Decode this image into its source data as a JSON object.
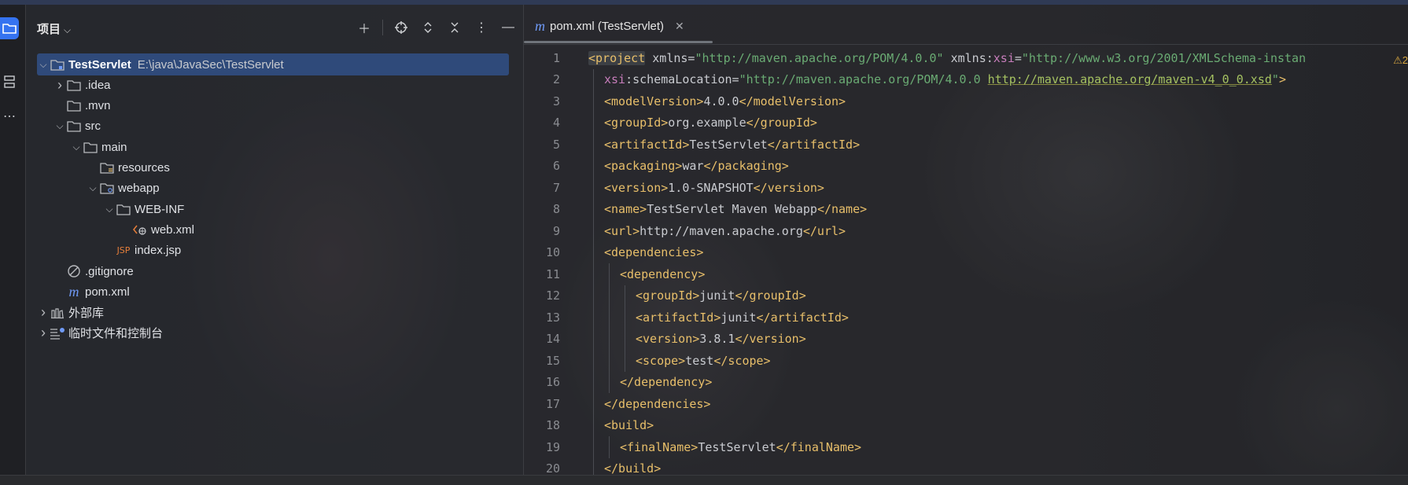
{
  "project_panel": {
    "title": "项目",
    "tree": [
      {
        "label": "TestServlet",
        "path": "E:\\java\\JavaSec\\TestServlet",
        "indent": 0,
        "arrow": "down",
        "icon": "module-folder-icon",
        "selected": true,
        "bold": true
      },
      {
        "label": ".idea",
        "indent": 1,
        "arrow": "right",
        "icon": "folder-icon"
      },
      {
        "label": ".mvn",
        "indent": 1,
        "arrow": "",
        "icon": "folder-icon"
      },
      {
        "label": "src",
        "indent": 1,
        "arrow": "down",
        "icon": "folder-icon"
      },
      {
        "label": "main",
        "indent": 2,
        "arrow": "down",
        "icon": "folder-icon"
      },
      {
        "label": "resources",
        "indent": 3,
        "arrow": "",
        "icon": "resources-folder-icon"
      },
      {
        "label": "webapp",
        "indent": 3,
        "arrow": "down",
        "icon": "web-folder-icon"
      },
      {
        "label": "WEB-INF",
        "indent": 4,
        "arrow": "down",
        "icon": "folder-icon"
      },
      {
        "label": "web.xml",
        "indent": 5,
        "arrow": "",
        "icon": "web-xml-icon"
      },
      {
        "label": "index.jsp",
        "indent": 4,
        "arrow": "",
        "icon": "jsp-file-icon"
      },
      {
        "label": ".gitignore",
        "indent": 1,
        "arrow": "",
        "icon": "gitignore-icon"
      },
      {
        "label": "pom.xml",
        "indent": 1,
        "arrow": "",
        "icon": "maven-file-icon"
      },
      {
        "label": "外部库",
        "indent": 0,
        "arrow": "right",
        "icon": "library-icon"
      },
      {
        "label": "临时文件和控制台",
        "indent": 0,
        "arrow": "right",
        "icon": "scratches-icon"
      }
    ]
  },
  "editor": {
    "tab_label": "pom.xml (TestServlet)",
    "tab_icon": "m",
    "inspection_count": "2",
    "lines": [
      {
        "n": "1",
        "indent": 0,
        "parts": [
          [
            "tag",
            "<project"
          ],
          [
            "attr",
            " xmlns="
          ],
          [
            "str",
            "\"http://maven.apache.org/POM/4.0.0\""
          ],
          [
            "attr",
            " xmlns:"
          ],
          [
            "ns",
            "xsi"
          ],
          [
            "attr",
            "="
          ],
          [
            "str",
            "\"http://www.w3.org/2001/XMLSchema-instan"
          ]
        ]
      },
      {
        "n": "2",
        "indent": 1,
        "parts": [
          [
            "ns",
            "xsi"
          ],
          [
            "attr",
            ":schemaLocation="
          ],
          [
            "str",
            "\"http://maven.apache.org/POM/4.0.0 "
          ],
          [
            "link",
            "http://maven.apache.org/maven-v4_0_0.xsd"
          ],
          [
            "str",
            "\""
          ],
          [
            "tag",
            ">"
          ]
        ]
      },
      {
        "n": "3",
        "indent": 1,
        "parts": [
          [
            "tag",
            "<modelVersion>"
          ],
          [
            "attr",
            "4.0.0"
          ],
          [
            "tag",
            "</modelVersion>"
          ]
        ]
      },
      {
        "n": "4",
        "indent": 1,
        "parts": [
          [
            "tag",
            "<groupId>"
          ],
          [
            "attr",
            "org.example"
          ],
          [
            "tag",
            "</groupId>"
          ]
        ]
      },
      {
        "n": "5",
        "indent": 1,
        "parts": [
          [
            "tag",
            "<artifactId>"
          ],
          [
            "attr",
            "TestServlet"
          ],
          [
            "tag",
            "</artifactId>"
          ]
        ]
      },
      {
        "n": "6",
        "indent": 1,
        "parts": [
          [
            "tag",
            "<packaging>"
          ],
          [
            "attr",
            "war"
          ],
          [
            "tag",
            "</packaging>"
          ]
        ]
      },
      {
        "n": "7",
        "indent": 1,
        "parts": [
          [
            "tag",
            "<version>"
          ],
          [
            "attr",
            "1.0-SNAPSHOT"
          ],
          [
            "tag",
            "</version>"
          ]
        ]
      },
      {
        "n": "8",
        "indent": 1,
        "parts": [
          [
            "tag",
            "<name>"
          ],
          [
            "attr",
            "TestServlet Maven Webapp"
          ],
          [
            "tag",
            "</name>"
          ]
        ]
      },
      {
        "n": "9",
        "indent": 1,
        "parts": [
          [
            "tag",
            "<url>"
          ],
          [
            "attr",
            "http://maven.apache.org"
          ],
          [
            "tag",
            "</url>"
          ]
        ]
      },
      {
        "n": "10",
        "indent": 1,
        "parts": [
          [
            "tag",
            "<dependencies>"
          ]
        ]
      },
      {
        "n": "11",
        "indent": 2,
        "parts": [
          [
            "tag",
            "<dependency>"
          ]
        ]
      },
      {
        "n": "12",
        "indent": 3,
        "parts": [
          [
            "tag",
            "<groupId>"
          ],
          [
            "attr",
            "junit"
          ],
          [
            "tag",
            "</groupId>"
          ]
        ]
      },
      {
        "n": "13",
        "indent": 3,
        "parts": [
          [
            "tag",
            "<artifactId>"
          ],
          [
            "attr",
            "junit"
          ],
          [
            "tag",
            "</artifactId>"
          ]
        ]
      },
      {
        "n": "14",
        "indent": 3,
        "parts": [
          [
            "tag",
            "<version>"
          ],
          [
            "attr",
            "3.8.1"
          ],
          [
            "tag",
            "</version>"
          ]
        ]
      },
      {
        "n": "15",
        "indent": 3,
        "parts": [
          [
            "tag",
            "<scope>"
          ],
          [
            "attr",
            "test"
          ],
          [
            "tag",
            "</scope>"
          ]
        ]
      },
      {
        "n": "16",
        "indent": 2,
        "parts": [
          [
            "tag",
            "</dependency>"
          ]
        ]
      },
      {
        "n": "17",
        "indent": 1,
        "parts": [
          [
            "tag",
            "</dependencies>"
          ]
        ]
      },
      {
        "n": "18",
        "indent": 1,
        "parts": [
          [
            "tag",
            "<build>"
          ]
        ]
      },
      {
        "n": "19",
        "indent": 2,
        "parts": [
          [
            "tag",
            "<finalName>"
          ],
          [
            "attr",
            "TestServlet"
          ],
          [
            "tag",
            "</finalName>"
          ]
        ]
      },
      {
        "n": "20",
        "indent": 1,
        "parts": [
          [
            "tag",
            "</build>"
          ]
        ]
      }
    ]
  }
}
